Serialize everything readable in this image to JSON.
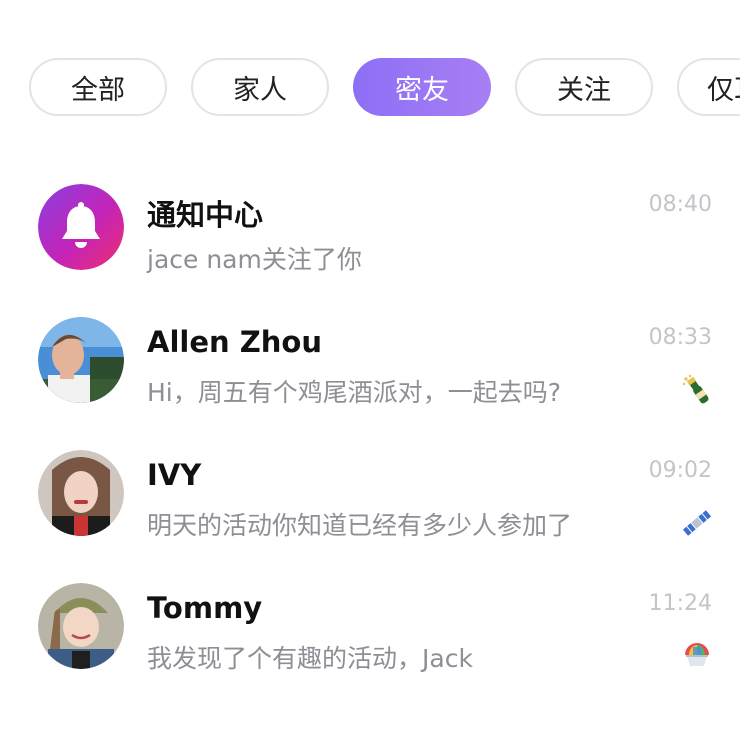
{
  "tabs": [
    {
      "label": "全部",
      "active": false
    },
    {
      "label": "家人",
      "active": false
    },
    {
      "label": "密友",
      "active": true
    },
    {
      "label": "关注",
      "active": false
    },
    {
      "label": "仅耳",
      "active": false
    }
  ],
  "accent_color": "#9a77f4",
  "conversations": [
    {
      "name": "通知中心",
      "preview": "jace nam关注了你",
      "time": "08:40",
      "avatar": "bell-icon",
      "badge": ""
    },
    {
      "name": "Allen Zhou",
      "preview": "Hi，周五有个鸡尾酒派对，一起去吗?",
      "time": "08:33",
      "avatar": "user-avatar",
      "badge": "champagne-emoji"
    },
    {
      "name": "IVY",
      "preview": "明天的活动你知道已经有多少人参加了",
      "time": "09:02",
      "avatar": "user-avatar",
      "badge": "satellite-emoji"
    },
    {
      "name": "Tommy",
      "preview": "我发现了个有趣的活动，Jack",
      "time": "11:24",
      "avatar": "user-avatar",
      "badge": "shaved-ice-emoji"
    }
  ]
}
